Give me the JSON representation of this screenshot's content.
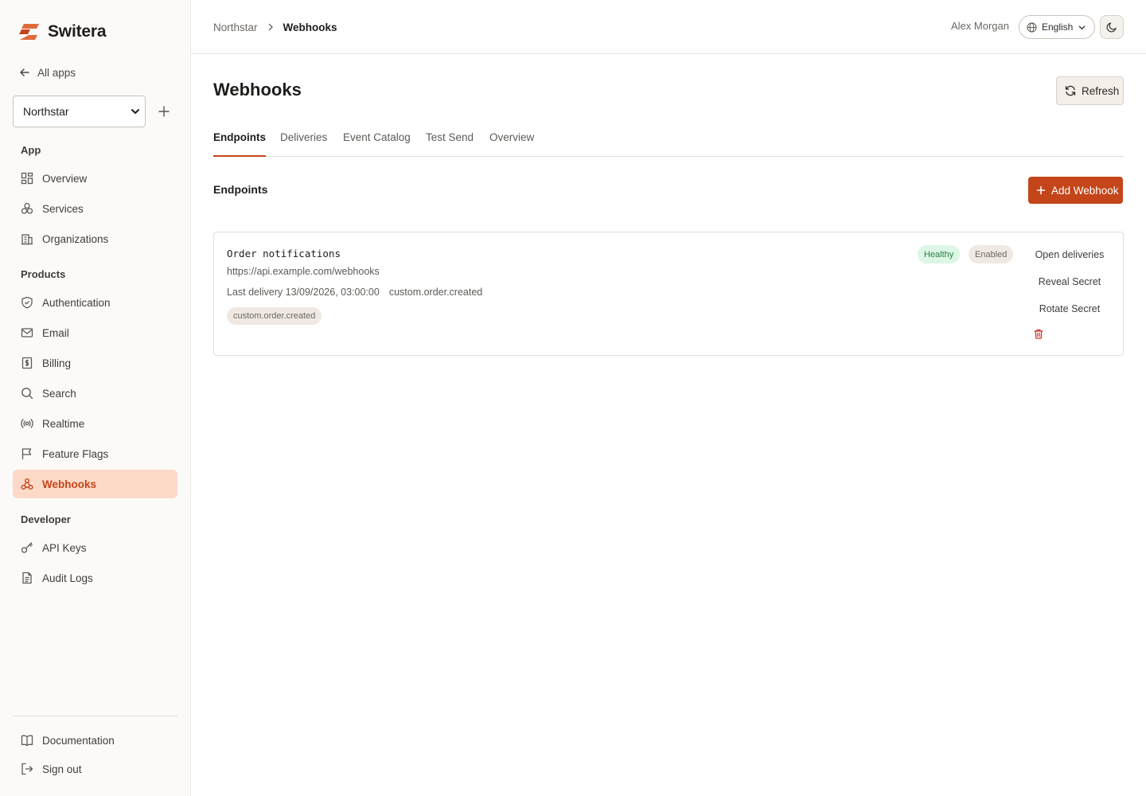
{
  "brand": {
    "name": "Switera",
    "accent": "#c4451a"
  },
  "sidebar": {
    "back_label": "All apps",
    "app_select": {
      "value": "Northstar"
    },
    "sections": [
      {
        "label": "App",
        "items": [
          {
            "label": "Overview",
            "icon": "dashboard-icon"
          },
          {
            "label": "Services",
            "icon": "services-icon"
          },
          {
            "label": "Organizations",
            "icon": "building-icon"
          }
        ]
      },
      {
        "label": "Products",
        "items": [
          {
            "label": "Authentication",
            "icon": "shield-icon"
          },
          {
            "label": "Email",
            "icon": "mail-icon"
          },
          {
            "label": "Billing",
            "icon": "billing-icon"
          },
          {
            "label": "Search",
            "icon": "search-icon"
          },
          {
            "label": "Realtime",
            "icon": "broadcast-icon"
          },
          {
            "label": "Feature Flags",
            "icon": "flag-icon"
          },
          {
            "label": "Webhooks",
            "icon": "webhook-icon",
            "active": true
          }
        ]
      },
      {
        "label": "Developer",
        "items": [
          {
            "label": "API Keys",
            "icon": "key-icon"
          },
          {
            "label": "Audit Logs",
            "icon": "document-icon"
          }
        ]
      }
    ],
    "footer": [
      {
        "label": "Documentation",
        "icon": "book-icon"
      },
      {
        "label": "Sign out",
        "icon": "logout-icon"
      }
    ]
  },
  "topbar": {
    "breadcrumb": [
      "Northstar",
      "Webhooks"
    ],
    "user_name": "Alex Morgan",
    "language": "English"
  },
  "main": {
    "title": "Webhooks",
    "refresh_label": "Refresh",
    "tabs": [
      {
        "label": "Endpoints",
        "active": true
      },
      {
        "label": "Deliveries"
      },
      {
        "label": "Event Catalog"
      },
      {
        "label": "Test Send"
      },
      {
        "label": "Overview"
      }
    ],
    "section_title": "Endpoints",
    "add_label": "Add Webhook",
    "endpoints": [
      {
        "name": "Order notifications",
        "url": "https://api.example.com/webhooks",
        "last_delivery": "Last delivery 13/09/2026, 03:00:00",
        "last_event": "custom.order.created",
        "events": [
          "custom.order.created"
        ],
        "health": "Healthy",
        "status": "Enabled",
        "actions": [
          "Open deliveries",
          "Reveal Secret",
          "Rotate Secret"
        ]
      }
    ]
  }
}
